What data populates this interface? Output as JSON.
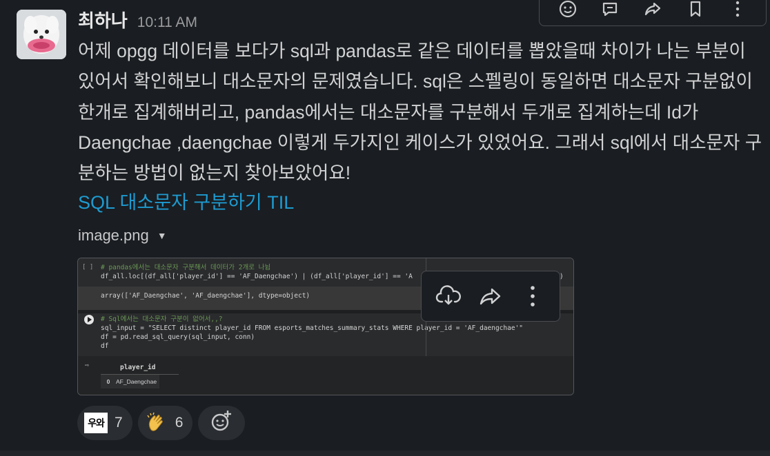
{
  "message": {
    "username": "최하나",
    "timestamp": "10:11 AM",
    "body": "어제 opgg 데이터를 보다가 sql과 pandas로 같은 데이터를 뽑았을때 차이가 나는 부분이 있어서 확인해보니 대소문자의 문제였습니다. sql은 스펠링이 동일하면 대소문자 구분없이 한개로 집계해버리고, pandas에서는 대소문자를 구분해서 두개로 집계하는데 Id가 Daengchae ,daengchae 이렇게 두가지인 케이스가 있었어요. 그래서 sql에서 대소문자 구분하는 방법이 없는지 찾아보았어요!",
    "link": "SQL 대소문자 구분하기 TIL"
  },
  "attachment": {
    "file_name": "image.png",
    "cell1_gutter": "[ ]",
    "cell1_comment": "# pandas에서는 대소문자 구분해서 데이터가 2개로 나뉨",
    "cell1_code": "df_all.loc[(df_all['player_id'] == 'AF_Daengchae') | (df_all['player_id'] == 'A",
    "cell1_code_tail": ")",
    "cell1_output": "array(['AF_Daengchae', 'AF_daengchae'], dtype=object)",
    "cell2_comment": "# Sql에서는 대소문자 구분이 없어서,,?",
    "cell2_line1": "sql_input = \"SELECT distinct player_id FROM esports_matches_summary_stats WHERE player_id = 'AF_daengchae'\"",
    "cell2_line2": "df = pd.read_sql_query(sql_input, conn)",
    "cell2_line3": "df",
    "table_header": "player_id",
    "table_index": "0",
    "table_value": "AF_Daengchae"
  },
  "reactions": [
    {
      "emoji": "wow-badge",
      "label": "우와",
      "count": "7"
    },
    {
      "emoji": "clap-hands",
      "count": "6"
    }
  ],
  "colors": {
    "background": "#1a1d21",
    "link": "#1d9bd1",
    "reaction_bg": "#2a2d31"
  }
}
